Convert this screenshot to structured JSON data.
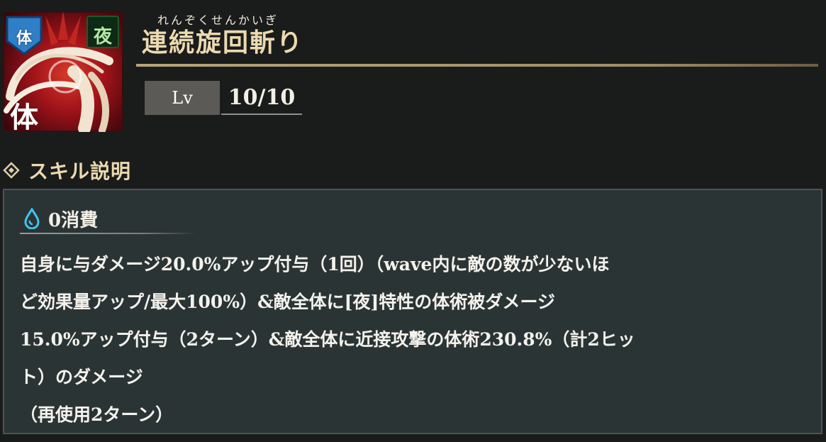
{
  "skill": {
    "type_badge": "体",
    "trait_badge": "夜",
    "icon_char": "体",
    "ruby": "れんぞくせんかいぎ",
    "name": "連続旋回斬り"
  },
  "level": {
    "label": "Lv",
    "value": "10/10"
  },
  "section": {
    "title": "スキル説明"
  },
  "description": {
    "cost": "0消費",
    "lines": [
      "自身に与ダメージ20.0%アップ付与（1回）（wave内に敵の数が少ないほ",
      "ど効果量アップ/最大100%）&敵全体に[夜]特性の体術被ダメージ",
      "15.0%アップ付与（2ターン）&敵全体に近接攻撃の体術230.8%（計2ヒッ",
      "ト）のダメージ",
      "（再使用2ターン）"
    ]
  },
  "colors": {
    "background": "#1a1c1b",
    "panel": "#2b3435",
    "gold_text": "#ecd9b0",
    "cost_icon": "#3fc6f0"
  },
  "icons": {
    "section": "diamond-icon",
    "cost": "water-drop-icon"
  }
}
